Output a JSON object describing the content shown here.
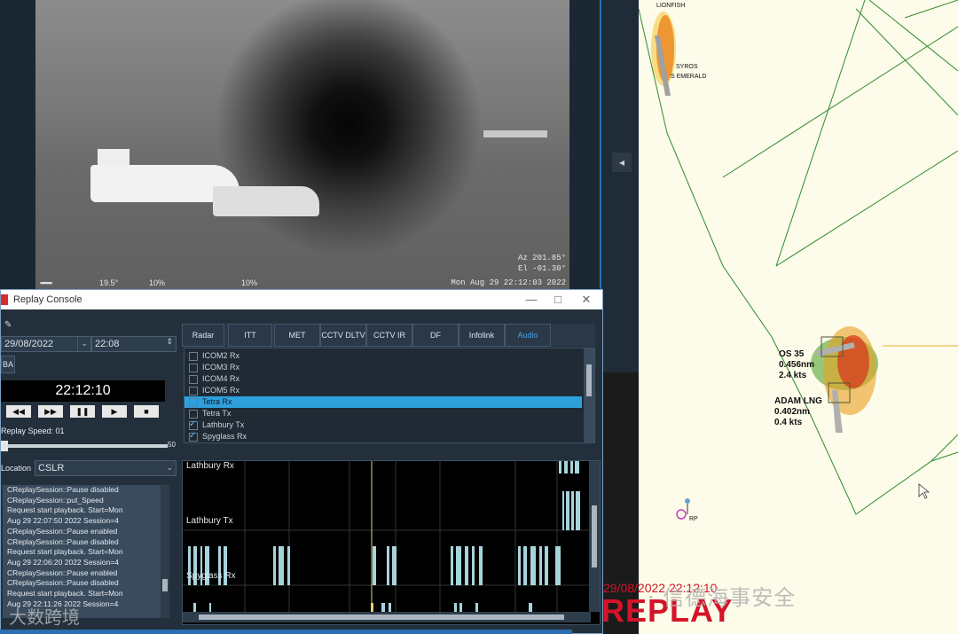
{
  "camera": {
    "az": "Az 201.85°",
    "el": "El -01.30°",
    "datetime": "Mon Aug 29 22:12:03 2022",
    "zoom_pct": "10%",
    "exposure": "10%",
    "fov": "19.5°",
    "side_button_glyph": "◂"
  },
  "map": {
    "labels": [
      "LIONFISH",
      "SYROS",
      "S EMERALD",
      "RP"
    ],
    "targets": [
      {
        "name": "OS 35",
        "range": "0.456nm",
        "speed": "2.4 kts"
      },
      {
        "name": "ADAM LNG",
        "range": "0.402nm",
        "speed": "0.4 kts"
      }
    ],
    "replay_timestamp": "29/08/2022 22:12:10",
    "replay_label": "REPLAY",
    "watermark": "· 信德海事安全"
  },
  "console": {
    "title": "Replay Console",
    "window_buttons": {
      "minimize": "—",
      "maximize": "□",
      "close": "✕"
    },
    "date": "29/08/2022",
    "time": "22:08",
    "ba_button": "BA",
    "clock": "22:12:10",
    "transport": {
      "rewind": "◀◀",
      "fast_forward": "▶▶",
      "pause": "❚❚",
      "play": "▶",
      "stop": "■"
    },
    "replay_speed_label": "Replay Speed: 01",
    "slider_max": "50",
    "location_label": "Location",
    "location_value": "CSLR",
    "log": [
      "CReplaySession::Pause disabled",
      "CReplaySession::put_Speed",
      "Request start playback. Start=Mon",
      "Aug 29 22:07:50 2022  Session=4",
      "CReplaySession::Pause enabled",
      "CReplaySession::Pause disabled",
      "Request start playback. Start=Mon",
      "Aug 29 22:06:20 2022  Session=4",
      "CReplaySession::Pause enabled",
      "CReplaySession::Pause disabled",
      "Request start playback. Start=Mon",
      "Aug 29 22:11:26 2022  Session=4"
    ],
    "tabs": [
      "Radar",
      "ITT",
      "MET",
      "CCTV DLTV",
      "CCTV IR",
      "DF",
      "Infolink",
      "Audio"
    ],
    "active_tab": "Audio",
    "channels": [
      {
        "label": "ICOM2 Rx",
        "checked": false,
        "selected": false
      },
      {
        "label": "ICOM3 Rx",
        "checked": false,
        "selected": false
      },
      {
        "label": "ICOM4 Rx",
        "checked": false,
        "selected": false
      },
      {
        "label": "ICOM5 Rx",
        "checked": false,
        "selected": false
      },
      {
        "label": "Tetra Rx",
        "checked": false,
        "selected": true
      },
      {
        "label": "Tetra Tx",
        "checked": false,
        "selected": false
      },
      {
        "label": "Lathbury Tx",
        "checked": true,
        "selected": false
      },
      {
        "label": "Spyglass Rx",
        "checked": true,
        "selected": false
      }
    ],
    "timeline_tracks": [
      "Lathbury Rx",
      "Lathbury Tx",
      "Spyglass Rx"
    ]
  },
  "footer_logo": "大数跨境"
}
